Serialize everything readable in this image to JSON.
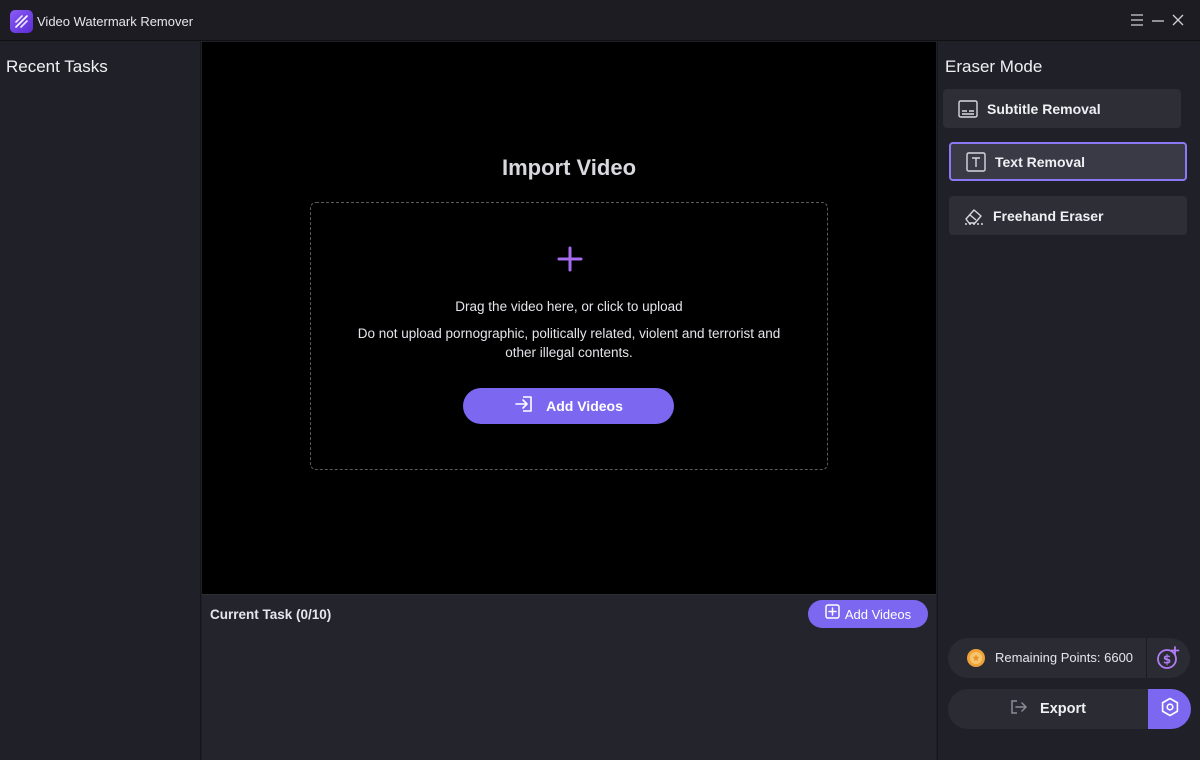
{
  "window": {
    "title": "Video Watermark Remover",
    "icons": [
      "app-logo-icon",
      "menu-icon",
      "minimize-icon",
      "close-icon"
    ]
  },
  "sidebar": {
    "title": "Recent Tasks"
  },
  "import": {
    "title": "Import Video",
    "hint": "Drag the video here, or click to upload",
    "warning": "Do not upload pornographic, politically related, violent and terrorist and other illegal contents.",
    "add_button_label": "Add Videos"
  },
  "tasks": {
    "title": "Current Task (0/10)",
    "add_button_label": "Add Videos"
  },
  "eraser": {
    "title": "Eraser Mode",
    "modes": [
      {
        "label": "Subtitle Removal",
        "icon": "subtitle-icon",
        "active": false
      },
      {
        "label": "Text Removal",
        "icon": "text-icon",
        "active": true
      },
      {
        "label": "Freehand Eraser",
        "icon": "eraser-icon",
        "active": false
      }
    ]
  },
  "points": {
    "label": "Remaining Points: 6600"
  },
  "export": {
    "label": "Export"
  },
  "colors": {
    "accent": "#7c68f0",
    "plus": "#a56cf0",
    "background": "#1f1f26",
    "canvas": "#000000"
  }
}
